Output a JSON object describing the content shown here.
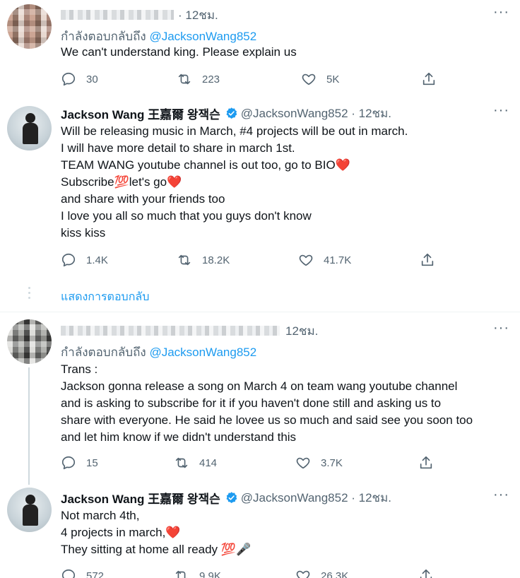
{
  "tweets": [
    {
      "time": "· 12ชม.",
      "reply_prefix": "กำลังตอบกลับถึง",
      "reply_mention": "@JacksonWang852",
      "text": "We can't understand king. Please explain us",
      "replies": "30",
      "retweets": "223",
      "likes": "5K"
    },
    {
      "name": "Jackson Wang 王嘉爾 왕잭슨",
      "handle_time": "@JacksonWang852 · 12ชม.",
      "text": "Will be releasing music in March, #4 projects will be out in march.\nI will have more detail to share in march 1st.\nTEAM WANG youtube channel is out too, go to BIO❤️\nSubscribe💯let's go❤️\nand share with your friends too\nI love you all so much that you guys don't know\nkiss kiss",
      "replies": "1.4K",
      "retweets": "18.2K",
      "likes": "41.7K",
      "show_thread": "แสดงการตอบกลับ"
    },
    {
      "time": "12ชม.",
      "reply_prefix": "กำลังตอบกลับถึง",
      "reply_mention": "@JacksonWang852",
      "text": "Trans :\nJackson gonna release a song on March 4 on team wang youtube channel\nand is asking to subscribe for it if you haven't done still and asking us to\nshare with everyone. He said he lovee us so much and said see you soon too\nand let him know if we didn't understand this",
      "replies": "15",
      "retweets": "414",
      "likes": "3.7K"
    },
    {
      "name": "Jackson Wang 王嘉爾 왕잭슨",
      "handle_time": "@JacksonWang852 · 12ชม.",
      "text": "Not march 4th,\n4 projects in march,❤️\nThey sitting at home all ready 💯🎤",
      "replies": "572",
      "retweets": "9.9K",
      "likes": "26.3K"
    }
  ],
  "colors": {
    "accent": "#1d9bf0",
    "muted": "#536471",
    "text": "#0f1419",
    "border": "#eff3f4"
  },
  "icons": [
    "reply-icon",
    "retweet-icon",
    "like-icon",
    "share-icon",
    "verified-icon",
    "more-icon"
  ]
}
